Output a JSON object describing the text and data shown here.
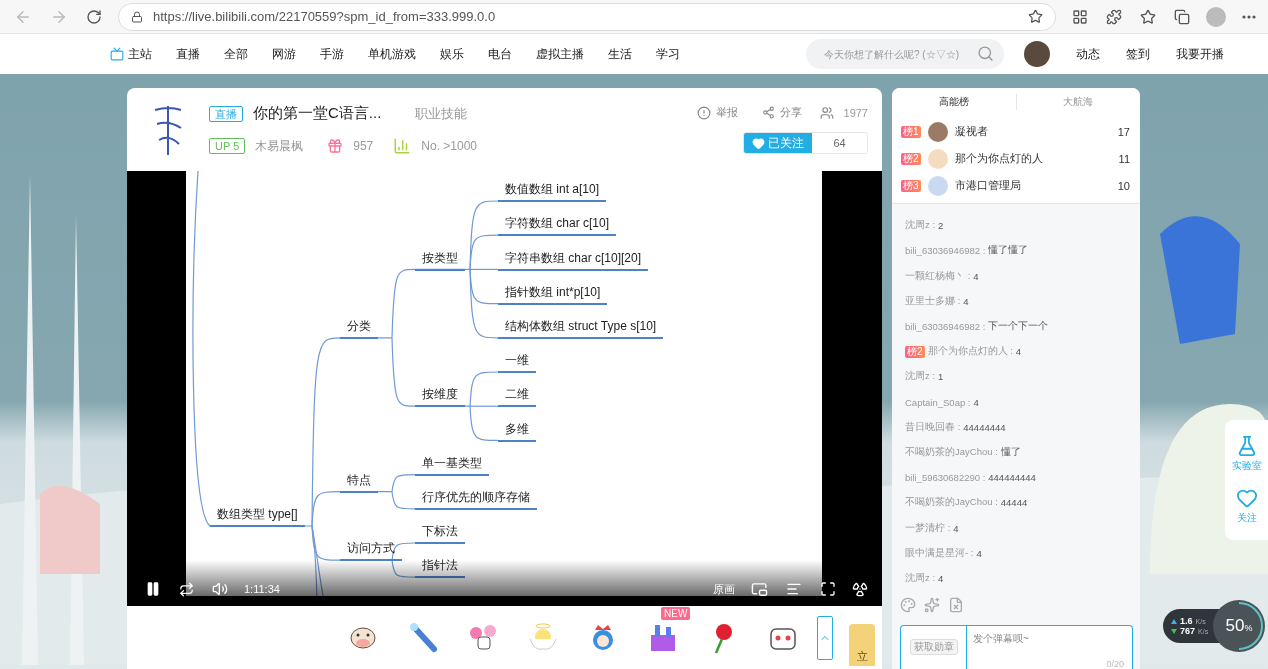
{
  "browser": {
    "url": "https://live.bilibili.com/22170559?spm_id_from=333.999.0.0"
  },
  "nav": {
    "items": [
      {
        "label": "主站",
        "kind": "home"
      },
      {
        "label": "直播",
        "kind": "link"
      },
      {
        "label": "全部",
        "kind": "link"
      },
      {
        "label": "网游",
        "kind": "link"
      },
      {
        "label": "手游",
        "kind": "link"
      },
      {
        "label": "单机游戏",
        "kind": "link"
      },
      {
        "label": "娱乐",
        "kind": "link"
      },
      {
        "label": "电台",
        "kind": "link"
      },
      {
        "label": "虚拟主播",
        "kind": "link"
      },
      {
        "label": "生活",
        "kind": "link"
      },
      {
        "label": "学习",
        "kind": "link"
      }
    ],
    "search": {
      "placeholder": "今天你想了解什么呢? (☆▽☆)"
    },
    "actions": [
      "动态",
      "签到",
      "我要开播"
    ]
  },
  "room": {
    "tag": "直播",
    "title": "你的第一堂C语言...",
    "category": "职业技能",
    "level": "UP 5",
    "anchor": "木易晨枫",
    "gifts": "957",
    "rank": "No. >1000",
    "report": "举报",
    "share": "分享",
    "viewers": "1977",
    "follow": {
      "label": "已关注",
      "followed": true
    },
    "fans": "64"
  },
  "player": {
    "playing": true,
    "time": "1:11:34",
    "quality": "原画",
    "mindmap": {
      "label": "数组类型 type[]",
      "children": [
        {
          "label": "分类",
          "children": [
            {
              "label": "按类型",
              "children": [
                {
                  "label": "数值数组 int a[10]"
                },
                {
                  "label": "字符数组 char c[10]"
                },
                {
                  "label": "字符串数组 char c[10][20]"
                },
                {
                  "label": "指针数组 int*p[10]"
                },
                {
                  "label": "结构体数组 struct Type s[10]"
                }
              ]
            },
            {
              "label": "按维度",
              "children": [
                {
                  "label": "一维"
                },
                {
                  "label": "二维"
                },
                {
                  "label": "多维"
                }
              ]
            }
          ]
        },
        {
          "label": "特点",
          "children": [
            {
              "label": "单一基类型"
            },
            {
              "label": "行序优先的顺序存储"
            }
          ]
        },
        {
          "label": "访问方式",
          "children": [
            {
              "label": "下标法"
            },
            {
              "label": "指针法"
            }
          ]
        }
      ]
    }
  },
  "gifts": [
    {
      "kind": "cow"
    },
    {
      "kind": "wand"
    },
    {
      "kind": "bouquet"
    },
    {
      "kind": "angel"
    },
    {
      "kind": "princess"
    },
    {
      "kind": "castle",
      "badge": "NEW"
    },
    {
      "kind": "rose"
    },
    {
      "kind": "tv"
    }
  ],
  "pinned": "立",
  "ranking": {
    "tabs": [
      {
        "label": "高能榜",
        "selected": true
      },
      {
        "label": "大航海",
        "selected": false
      }
    ],
    "rows": [
      {
        "badge": "榜1",
        "name": "凝视者",
        "score": "17"
      },
      {
        "badge": "榜2",
        "name": "那个为你点灯的人",
        "score": "11"
      },
      {
        "badge": "榜3",
        "name": "市港口管理局",
        "score": "10"
      }
    ]
  },
  "chat": [
    {
      "user": "沈周z :",
      "text": "2"
    },
    {
      "user": "bili_63036946982 :",
      "text": "懂了懂了"
    },
    {
      "user": "一颗红杨梅丶 :",
      "text": "4"
    },
    {
      "user": "亚里士多娜 :",
      "text": "4"
    },
    {
      "user": "bili_63036946982 :",
      "text": "下一个下一个"
    },
    {
      "badge": "榜2",
      "user": "那个为你点灯的人 :",
      "text": "4"
    },
    {
      "user": "沈周z :",
      "text": "1"
    },
    {
      "user": "Captain_S0ap :",
      "text": "4"
    },
    {
      "user": "昔日晚回春 :",
      "text": "44444444"
    },
    {
      "user": "不喝奶茶的JayChou :",
      "text": "懂了"
    },
    {
      "user": "bili_59630682290 :",
      "text": "444444444"
    },
    {
      "user": "不喝奶茶的JayChou :",
      "text": "44444"
    },
    {
      "user": "一梦清柠 :",
      "text": "4"
    },
    {
      "user": "眼中满是星河- :",
      "text": "4"
    },
    {
      "user": "沈周z :",
      "text": "4"
    }
  ],
  "composer": {
    "medal": "获取勋章",
    "placeholder": "发个弹幕呗~",
    "counter": "0/20"
  },
  "dock": [
    {
      "kind": "lab",
      "label": "实验室"
    },
    {
      "kind": "follow",
      "label": "关注"
    }
  ],
  "net": {
    "up": "1.6",
    "up_unit": "K/s",
    "down": "767",
    "down_unit": "K/s",
    "load": "50",
    "load_unit": "%",
    "level": 0.5
  }
}
